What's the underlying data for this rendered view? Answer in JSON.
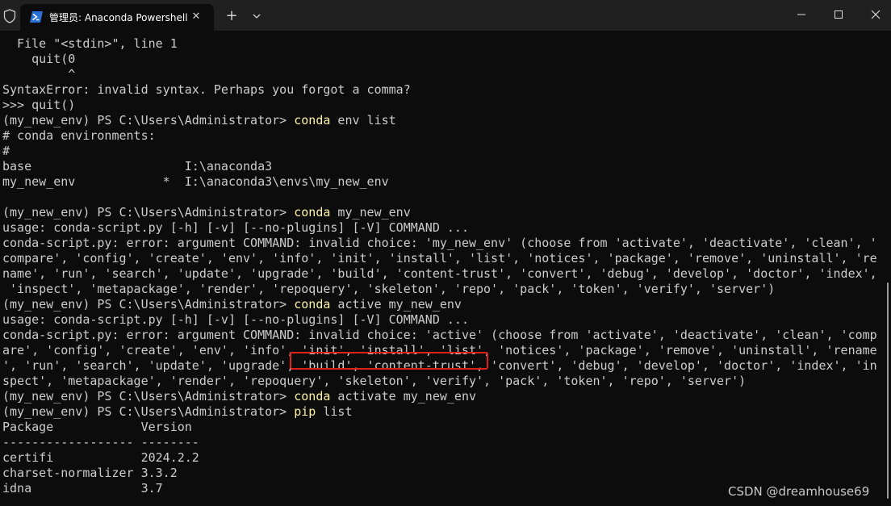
{
  "window": {
    "tab_title": "管理员: Anaconda Powershell",
    "tab_close": "✕",
    "new_tab": "+",
    "colors": {
      "titlebar": "#202020",
      "terminal_bg": "#0c0c0c",
      "text": "#cccccc",
      "command": "#f9f1a5",
      "highlight": "#e0201a"
    },
    "icons": [
      "shield-icon",
      "powershell-icon",
      "close-icon",
      "plus-icon",
      "chevron-down-icon",
      "minimize-icon",
      "maximize-icon",
      "close-window-icon"
    ]
  },
  "terminal": {
    "lines": [
      [
        {
          "t": "  File \"<stdin>\", line 1",
          "c": "txt"
        }
      ],
      [
        {
          "t": "    quit(0",
          "c": "txt"
        }
      ],
      [
        {
          "t": "         ^",
          "c": "txt"
        }
      ],
      [
        {
          "t": "SyntaxError: invalid syntax. Perhaps you forgot a comma?",
          "c": "txt"
        }
      ],
      [
        {
          "t": ">>> quit()",
          "c": "txt"
        }
      ],
      [
        {
          "t": "(my_new_env) PS C:\\Users\\Administrator> ",
          "c": "txt"
        },
        {
          "t": "conda",
          "c": "cmd"
        },
        {
          "t": " env list",
          "c": "txt"
        }
      ],
      [
        {
          "t": "# conda environments:",
          "c": "txt"
        }
      ],
      [
        {
          "t": "#",
          "c": "txt"
        }
      ],
      [
        {
          "t": "base                     I:\\anaconda3",
          "c": "txt"
        }
      ],
      [
        {
          "t": "my_new_env            *  I:\\anaconda3\\envs\\my_new_env",
          "c": "txt"
        }
      ],
      [
        {
          "t": "",
          "c": "txt"
        }
      ],
      [
        {
          "t": "(my_new_env) PS C:\\Users\\Administrator> ",
          "c": "txt"
        },
        {
          "t": "conda",
          "c": "cmd"
        },
        {
          "t": " my_new_env",
          "c": "txt"
        }
      ],
      [
        {
          "t": "usage: conda-script.py [-h] [-v] [--no-plugins] [-V] COMMAND ...",
          "c": "txt"
        }
      ],
      [
        {
          "t": "conda-script.py: error: argument COMMAND: invalid choice: 'my_new_env' (choose from 'activate', 'deactivate', 'clean', '",
          "c": "txt"
        }
      ],
      [
        {
          "t": "compare', 'config', 'create', 'env', 'info', 'init', 'install', 'list', 'notices', 'package', 'remove', 'uninstall', 're",
          "c": "txt"
        }
      ],
      [
        {
          "t": "name', 'run', 'search', 'update', 'upgrade', 'build', 'content-trust', 'convert', 'debug', 'develop', 'doctor', 'index',",
          "c": "txt"
        }
      ],
      [
        {
          "t": " 'inspect', 'metapackage', 'render', 'repoquery', 'skeleton', 'repo', 'pack', 'token', 'verify', 'server')",
          "c": "txt"
        }
      ],
      [
        {
          "t": "(my_new_env) PS C:\\Users\\Administrator> ",
          "c": "txt"
        },
        {
          "t": "conda",
          "c": "cmd"
        },
        {
          "t": " active my_new_env",
          "c": "txt"
        }
      ],
      [
        {
          "t": "usage: conda-script.py [-h] [-v] [--no-plugins] [-V] COMMAND ...",
          "c": "txt"
        }
      ],
      [
        {
          "t": "conda-script.py: error: argument COMMAND: invalid choice: 'active' (choose from 'activate', 'deactivate', 'clean', 'comp",
          "c": "txt"
        }
      ],
      [
        {
          "t": "are', 'config', 'create', 'env', 'info', 'init', 'install', 'list', 'notices', 'package', 'remove', 'uninstall', 'rename",
          "c": "txt"
        }
      ],
      [
        {
          "t": "', 'run', 'search', 'update', 'upgrade', 'build', 'content-trust', 'convert', 'debug', 'develop', 'doctor', 'index', 'in",
          "c": "txt"
        }
      ],
      [
        {
          "t": "spect', 'metapackage', 'render', 'repoquery', 'skeleton', 'verify', 'pack', 'token', 'repo', 'server')",
          "c": "txt"
        }
      ],
      [
        {
          "t": "(my_new_env) PS C:\\Users\\Administrator> ",
          "c": "txt"
        },
        {
          "t": "conda",
          "c": "cmd"
        },
        {
          "t": " activate my_new_env",
          "c": "txt"
        }
      ],
      [
        {
          "t": "(my_new_env) PS C:\\Users\\Administrator> ",
          "c": "txt"
        },
        {
          "t": "pip",
          "c": "cmd"
        },
        {
          "t": " list",
          "c": "txt"
        }
      ],
      [
        {
          "t": "Package            Version",
          "c": "txt"
        }
      ],
      [
        {
          "t": "------------------ --------",
          "c": "txt"
        }
      ],
      [
        {
          "t": "certifi            2024.2.2",
          "c": "txt"
        }
      ],
      [
        {
          "t": "charset-normalizer 3.3.2",
          "c": "txt"
        }
      ],
      [
        {
          "t": "idna               3.7",
          "c": "txt"
        }
      ]
    ]
  },
  "watermark": "CSDN @dreamhouse69"
}
